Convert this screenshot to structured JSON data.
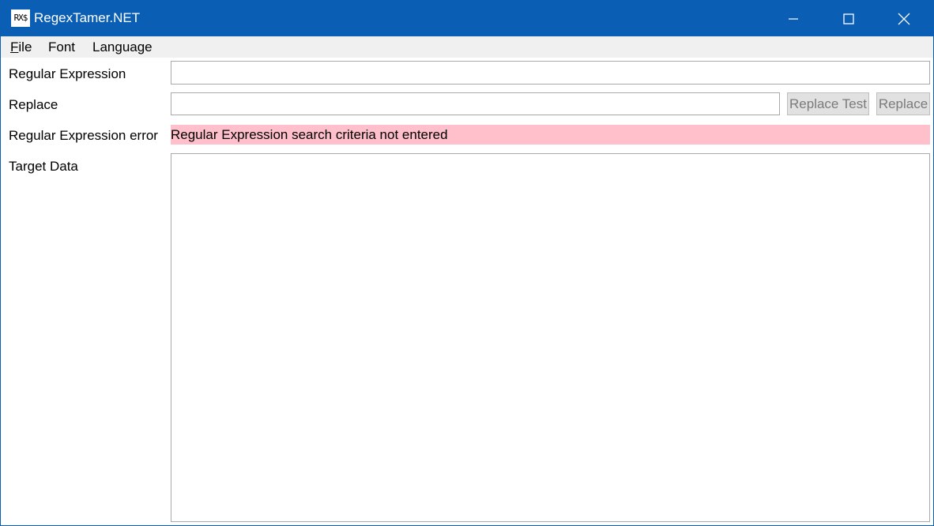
{
  "window": {
    "title": "RegexTamer.NET",
    "icon_text": "RX$",
    "accent_color": "#0a5fb4",
    "buttons": [
      "minimize-icon",
      "maximize-icon",
      "close-icon"
    ]
  },
  "menu": {
    "items": [
      {
        "label_first": "F",
        "label_rest": "ile"
      },
      {
        "label": "Font"
      },
      {
        "label": "Language"
      }
    ]
  },
  "form": {
    "regex_label": "Regular Expression",
    "regex_value": "",
    "replace_label": "Replace",
    "replace_value": "",
    "replace_test_button": "Replace Test",
    "replace_button": "Replace",
    "error_label": "Regular Expression error",
    "error_message": "Regular Expression search criteria not entered",
    "error_color": "#ffc0cb",
    "target_label": "Target Data",
    "target_value": ""
  }
}
